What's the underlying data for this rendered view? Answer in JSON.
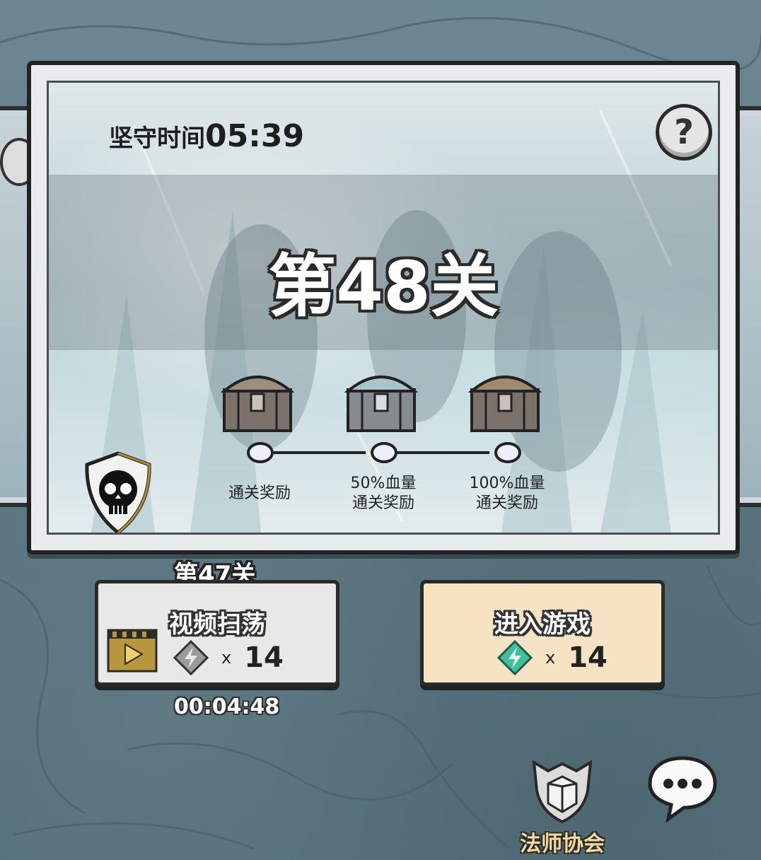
{
  "hold_time": {
    "label": "坚守时间",
    "value": "05:39"
  },
  "help": {
    "glyph": "?"
  },
  "level": {
    "title": "第48关"
  },
  "rewards": [
    {
      "label": "通关奖励",
      "chest": "bronze-chest"
    },
    {
      "label": "50%血量\n通关奖励",
      "chest": "silver-chest"
    },
    {
      "label": "100%血量\n通关奖励",
      "chest": "bronze-chest"
    }
  ],
  "prev_level": {
    "title": "第47关"
  },
  "video_sweep": {
    "label": "视频扫荡",
    "cost_x": "x",
    "cost": "14",
    "timer": "00:04:48"
  },
  "enter_game": {
    "label": "进入游戏",
    "cost_x": "x",
    "cost": "14"
  },
  "guild": {
    "label": "法师协会"
  },
  "colors": {
    "energy_gem": "#3fbf9a",
    "energy_gem_disabled": "#9a9a9a",
    "guild_text": "#f3d9a0"
  }
}
